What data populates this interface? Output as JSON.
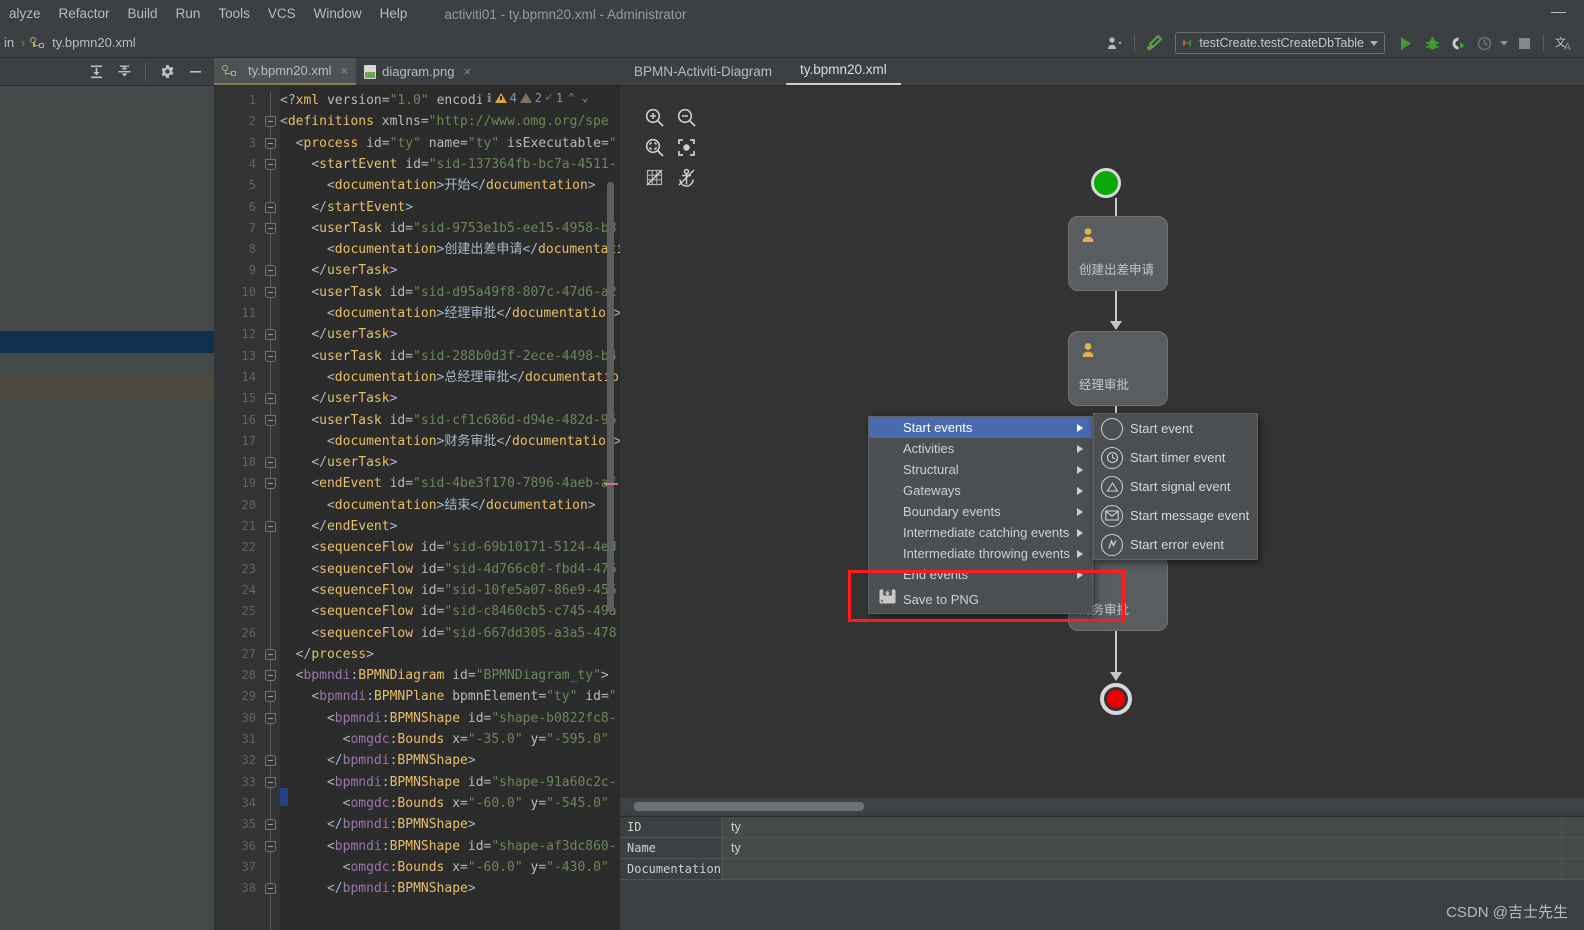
{
  "window": {
    "title": "activiti01 - ty.bpmn20.xml - Administrator",
    "minimize_label": "—"
  },
  "menubar": {
    "items": [
      {
        "label": "alyze"
      },
      {
        "label": "Refactor"
      },
      {
        "label": "Build"
      },
      {
        "label": "Run"
      },
      {
        "label": "Tools"
      },
      {
        "label": "VCS"
      },
      {
        "label": "Window"
      },
      {
        "label": "Help"
      }
    ]
  },
  "breadcrumb": {
    "segments": [
      "in",
      "ty.bpmn20.xml"
    ],
    "separator": "›"
  },
  "run_toolbar": {
    "config_name": "testCreate.testCreateDbTable",
    "icons": [
      "user-settings-icon",
      "build-hammer-icon",
      "run-icon",
      "debug-icon",
      "run-with-coverage-icon",
      "profile-icon",
      "stop-icon",
      "translate-icon"
    ]
  },
  "left_panel": {
    "toolbar_icons": [
      "expand-all-icon",
      "collapse-all-icon",
      "settings-gear-icon",
      "hide-icon"
    ]
  },
  "editor_tabs": [
    {
      "label": "ty.bpmn20.xml",
      "icon": "bpmn-file-icon",
      "active": true,
      "close": "×"
    },
    {
      "label": "diagram.png",
      "icon": "png-file-icon",
      "active": false,
      "close": "×"
    }
  ],
  "inspections": {
    "info_icon": "inspection-info-icon",
    "warning_count": "4",
    "weak_warning_count": "2",
    "ok_count": "1",
    "prev_label": "⌃",
    "next_label": "⌄"
  },
  "code": {
    "lines": [
      {
        "n": 1,
        "fold": null,
        "html": "<span class=\"k-ang\">&lt;?</span><span class=\"k-tag\">xml</span> <span class=\"k-attr\">version</span><span class=\"k-ang\">=</span><span class=\"k-str\">\"1.0\"</span> <span class=\"k-attr\">encodi</span>"
      },
      {
        "n": 2,
        "fold": "open",
        "html": "<span class=\"k-ang\">&lt;</span><span class=\"k-tag\">definitions</span> <span class=\"k-attr\">xmlns</span><span class=\"k-ang\">=</span><span class=\"k-str\">\"http://www.omg.org/spe</span>"
      },
      {
        "n": 3,
        "fold": "open",
        "html": "  <span class=\"k-ang\">&lt;</span><span class=\"k-tag\">process</span> <span class=\"k-attr\">id</span><span class=\"k-ang\">=</span><span class=\"k-str\">\"ty\"</span> <span class=\"k-attr\">name</span><span class=\"k-ang\">=</span><span class=\"k-str\">\"ty\"</span> <span class=\"k-attr\">isExecutable</span><span class=\"k-ang\">=</span><span class=\"k-str\">\"</span>"
      },
      {
        "n": 4,
        "fold": "open",
        "html": "    <span class=\"k-ang\">&lt;</span><span class=\"k-tag\">startEvent</span> <span class=\"k-attr\">id</span><span class=\"k-ang\">=</span><span class=\"k-str\">\"sid-137364fb-bc7a-4511-</span>"
      },
      {
        "n": 5,
        "fold": null,
        "html": "      <span class=\"k-ang\">&lt;</span><span class=\"k-tag\">documentation</span><span class=\"k-ang\">&gt;</span><span class=\"k-doc\">开始</span><span class=\"k-ang\">&lt;/</span><span class=\"k-tag\">documentation</span><span class=\"k-ang\">&gt;</span>"
      },
      {
        "n": 6,
        "fold": "close",
        "html": "    <span class=\"k-ang\">&lt;/</span><span class=\"k-tag\">startEvent</span><span class=\"k-ang\">&gt;</span>"
      },
      {
        "n": 7,
        "fold": "open",
        "html": "    <span class=\"k-ang\">&lt;</span><span class=\"k-tag\">userTask</span> <span class=\"k-attr\">id</span><span class=\"k-ang\">=</span><span class=\"k-str\">\"sid-9753e1b5-ee15-4958-b8</span>"
      },
      {
        "n": 8,
        "fold": null,
        "html": "      <span class=\"k-ang\">&lt;</span><span class=\"k-tag\">documentation</span><span class=\"k-ang\">&gt;</span><span class=\"k-doc\">创建出差申请</span><span class=\"k-ang\">&lt;/</span><span class=\"k-tag\">documentati</span>"
      },
      {
        "n": 9,
        "fold": "close",
        "html": "    <span class=\"k-ang\">&lt;/</span><span class=\"k-tag\">userTask</span><span class=\"k-ang\">&gt;</span>"
      },
      {
        "n": 10,
        "fold": "open",
        "html": "    <span class=\"k-ang\">&lt;</span><span class=\"k-tag\">userTask</span> <span class=\"k-attr\">id</span><span class=\"k-ang\">=</span><span class=\"k-str\">\"sid-d95a49f8-807c-47d6-a2</span>"
      },
      {
        "n": 11,
        "fold": null,
        "html": "      <span class=\"k-ang\">&lt;</span><span class=\"k-tag\">documentation</span><span class=\"k-ang\">&gt;</span><span class=\"k-doc\">经理审批</span><span class=\"k-ang\">&lt;/</span><span class=\"k-tag\">documentation</span><span class=\"k-ang\">&gt;</span>"
      },
      {
        "n": 12,
        "fold": "close",
        "html": "    <span class=\"k-ang\">&lt;/</span><span class=\"k-tag\">userTask</span><span class=\"k-ang\">&gt;</span>"
      },
      {
        "n": 13,
        "fold": "open",
        "html": "    <span class=\"k-ang\">&lt;</span><span class=\"k-tag\">userTask</span> <span class=\"k-attr\">id</span><span class=\"k-ang\">=</span><span class=\"k-str\">\"sid-288b0d3f-2ece-4498-b4</span>"
      },
      {
        "n": 14,
        "fold": null,
        "html": "      <span class=\"k-ang\">&lt;</span><span class=\"k-tag\">documentation</span><span class=\"k-ang\">&gt;</span><span class=\"k-doc\">总经理审批</span><span class=\"k-ang\">&lt;/</span><span class=\"k-tag\">documentatio</span>"
      },
      {
        "n": 15,
        "fold": "close",
        "html": "    <span class=\"k-ang\">&lt;/</span><span class=\"k-tag\">userTask</span><span class=\"k-ang\">&gt;</span>"
      },
      {
        "n": 16,
        "fold": "open",
        "html": "    <span class=\"k-ang\">&lt;</span><span class=\"k-tag\">userTask</span> <span class=\"k-attr\">id</span><span class=\"k-ang\">=</span><span class=\"k-str\">\"sid-cf1c686d-d94e-482d-95</span>"
      },
      {
        "n": 17,
        "fold": null,
        "html": "      <span class=\"k-ang\">&lt;</span><span class=\"k-tag\">documentation</span><span class=\"k-ang\">&gt;</span><span class=\"k-doc\">财务审批</span><span class=\"k-ang\">&lt;/</span><span class=\"k-tag\">documentation</span><span class=\"k-ang\">&gt;</span>"
      },
      {
        "n": 18,
        "fold": "close",
        "html": "    <span class=\"k-ang\">&lt;/</span><span class=\"k-tag\">userTask</span><span class=\"k-ang\">&gt;</span>"
      },
      {
        "n": 19,
        "fold": "open",
        "html": "    <span class=\"k-ang\">&lt;</span><span class=\"k-tag\">endEvent</span> <span class=\"k-attr\">id</span><span class=\"k-ang\">=</span><span class=\"k-str\">\"sid-4be3f170-7896-4aeb-af</span>"
      },
      {
        "n": 20,
        "fold": null,
        "html": "      <span class=\"k-ang\">&lt;</span><span class=\"k-tag\">documentation</span><span class=\"k-ang\">&gt;</span><span class=\"k-doc\">结束</span><span class=\"k-ang\">&lt;/</span><span class=\"k-tag\">documentation</span><span class=\"k-ang\">&gt;</span>"
      },
      {
        "n": 21,
        "fold": "close",
        "html": "    <span class=\"k-ang\">&lt;/</span><span class=\"k-tag\">endEvent</span><span class=\"k-ang\">&gt;</span>"
      },
      {
        "n": 22,
        "fold": null,
        "html": "    <span class=\"k-ang\">&lt;</span><span class=\"k-tag\">sequenceFlow</span> <span class=\"k-attr\">id</span><span class=\"k-ang\">=</span><span class=\"k-str\">\"sid-69b10171-5124-4ed</span>"
      },
      {
        "n": 23,
        "fold": null,
        "html": "    <span class=\"k-ang\">&lt;</span><span class=\"k-tag\">sequenceFlow</span> <span class=\"k-attr\">id</span><span class=\"k-ang\">=</span><span class=\"k-str\">\"sid-4d766c0f-fbd4-476</span>"
      },
      {
        "n": 24,
        "fold": null,
        "html": "    <span class=\"k-ang\">&lt;</span><span class=\"k-tag\">sequenceFlow</span> <span class=\"k-attr\">id</span><span class=\"k-ang\">=</span><span class=\"k-str\">\"sid-10fe5a07-86e9-456</span>"
      },
      {
        "n": 25,
        "fold": null,
        "html": "    <span class=\"k-ang\">&lt;</span><span class=\"k-tag\">sequenceFlow</span> <span class=\"k-attr\">id</span><span class=\"k-ang\">=</span><span class=\"k-str\">\"sid-c8460cb5-c745-49a</span>"
      },
      {
        "n": 26,
        "fold": null,
        "html": "    <span class=\"k-ang\">&lt;</span><span class=\"k-tag\">sequenceFlow</span> <span class=\"k-attr\">id</span><span class=\"k-ang\">=</span><span class=\"k-str\">\"sid-667dd305-a3a5-478</span>"
      },
      {
        "n": 27,
        "fold": "close",
        "html": "  <span class=\"k-ang\">&lt;/</span><span class=\"k-tag\">process</span><span class=\"k-ang\">&gt;</span>"
      },
      {
        "n": 28,
        "fold": "open",
        "html": "  <span class=\"k-ang\">&lt;</span><span class=\"k-ns\">bpmndi</span><span class=\"k-ang\">:</span><span class=\"k-tag\">BPMNDiagram</span> <span class=\"k-attr\">id</span><span class=\"k-ang\">=</span><span class=\"k-str\">\"BPMNDiagram_ty\"</span><span class=\"k-ang\">&gt;</span>"
      },
      {
        "n": 29,
        "fold": "open",
        "html": "    <span class=\"k-ang\">&lt;</span><span class=\"k-ns\">bpmndi</span><span class=\"k-ang\">:</span><span class=\"k-tag\">BPMNPlane</span> <span class=\"k-attr\">bpmnElement</span><span class=\"k-ang\">=</span><span class=\"k-str\">\"ty\"</span> <span class=\"k-attr\">id</span><span class=\"k-ang\">=</span><span class=\"k-str\">\"</span>"
      },
      {
        "n": 30,
        "fold": "open",
        "html": "      <span class=\"k-ang\">&lt;</span><span class=\"k-ns\">bpmndi</span><span class=\"k-ang\">:</span><span class=\"k-tag\">BPMNShape</span> <span class=\"k-attr\">id</span><span class=\"k-ang\">=</span><span class=\"k-str\">\"shape-b0822fc8-</span>"
      },
      {
        "n": 31,
        "fold": null,
        "html": "        <span class=\"k-ang\">&lt;</span><span class=\"k-ns\">omgdc</span><span class=\"k-ang\">:</span><span class=\"k-tag\">Bounds</span> <span class=\"k-attr\">x</span><span class=\"k-ang\">=</span><span class=\"k-str\">\"-35.0\"</span> <span class=\"k-attr\">y</span><span class=\"k-ang\">=</span><span class=\"k-str\">\"-595.0\"</span> "
      },
      {
        "n": 32,
        "fold": "close",
        "html": "      <span class=\"k-ang\">&lt;/</span><span class=\"k-ns\">bpmndi</span><span class=\"k-ang\">:</span><span class=\"k-tag\">BPMNShape</span><span class=\"k-ang\">&gt;</span>"
      },
      {
        "n": 33,
        "fold": "open",
        "html": "      <span class=\"k-ang\">&lt;</span><span class=\"k-ns\">bpmndi</span><span class=\"k-ang\">:</span><span class=\"k-tag\">BPMNShape</span> <span class=\"k-attr\">id</span><span class=\"k-ang\">=</span><span class=\"k-str\">\"shape-91a60c2c-</span>"
      },
      {
        "n": 34,
        "fold": null,
        "html": "        <span class=\"k-ang\">&lt;</span><span class=\"k-ns\">omgdc</span><span class=\"k-ang\">:</span><span class=\"k-tag\">Bounds</span> <span class=\"k-attr\">x</span><span class=\"k-ang\">=</span><span class=\"k-str\">\"-60.0\"</span> <span class=\"k-attr\">y</span><span class=\"k-ang\">=</span><span class=\"k-str\">\"-545.0\"</span> "
      },
      {
        "n": 35,
        "fold": "close",
        "html": "      <span class=\"k-ang\">&lt;/</span><span class=\"k-ns\">bpmndi</span><span class=\"k-ang\">:</span><span class=\"k-tag\">BPMNShape</span><span class=\"k-ang\">&gt;</span>"
      },
      {
        "n": 36,
        "fold": "open",
        "html": "      <span class=\"k-ang\">&lt;</span><span class=\"k-ns\">bpmndi</span><span class=\"k-ang\">:</span><span class=\"k-tag\">BPMNShape</span> <span class=\"k-attr\">id</span><span class=\"k-ang\">=</span><span class=\"k-str\">\"shape-af3dc860-</span>"
      },
      {
        "n": 37,
        "fold": null,
        "html": "        <span class=\"k-ang\">&lt;</span><span class=\"k-ns\">omgdc</span><span class=\"k-ang\">:</span><span class=\"k-tag\">Bounds</span> <span class=\"k-attr\">x</span><span class=\"k-ang\">=</span><span class=\"k-str\">\"-60.0\"</span> <span class=\"k-attr\">y</span><span class=\"k-ang\">=</span><span class=\"k-str\">\"-430.0\"</span> "
      },
      {
        "n": 38,
        "fold": "close",
        "html": "      <span class=\"k-ang\">&lt;/</span><span class=\"k-ns\">bpmndi</span><span class=\"k-ang\">:</span><span class=\"k-tag\">BPMNShape</span><span class=\"k-ang\">&gt;</span>"
      }
    ]
  },
  "diagram": {
    "tabs": [
      {
        "label": "BPMN-Activiti-Diagram",
        "active": false
      },
      {
        "label": "ty.bpmn20.xml",
        "active": true
      }
    ],
    "toolbar": [
      {
        "name": "zoom-in-icon"
      },
      {
        "name": "zoom-out-icon"
      },
      {
        "name": "fit-content-icon"
      },
      {
        "name": "actual-size-icon"
      },
      {
        "name": "toggle-grid-icon"
      },
      {
        "name": "toggle-snap-anchor-icon"
      }
    ],
    "nodes": [
      {
        "type": "start-event",
        "label": "",
        "color": "#0aa80a"
      },
      {
        "type": "user-task",
        "label": "创建出差申请"
      },
      {
        "type": "user-task",
        "label": "经理审批"
      },
      {
        "type": "user-task",
        "label": "总经理审批"
      },
      {
        "type": "user-task",
        "label": "财务审批"
      },
      {
        "type": "end-event",
        "label": "",
        "color": "#ee0000"
      }
    ]
  },
  "context_menu": {
    "items": [
      {
        "label": "Start events",
        "submenu": true,
        "selected": true
      },
      {
        "label": "Activities",
        "submenu": true,
        "selected": false
      },
      {
        "label": "Structural",
        "submenu": true,
        "selected": false
      },
      {
        "label": "Gateways",
        "submenu": true,
        "selected": false
      },
      {
        "label": "Boundary events",
        "submenu": true,
        "selected": false
      },
      {
        "label": "Intermediate catching events",
        "submenu": true,
        "selected": false
      },
      {
        "label": "Intermediate throwing events",
        "submenu": true,
        "selected": false
      },
      {
        "label": "End events",
        "submenu": true,
        "selected": false
      },
      {
        "label": "Save to PNG",
        "submenu": false,
        "selected": false,
        "icon": "save-png-icon"
      }
    ]
  },
  "submenu": {
    "items": [
      {
        "label": "Start event",
        "icon": "circle-icon"
      },
      {
        "label": "Start timer event",
        "icon": "timer-icon"
      },
      {
        "label": "Start signal event",
        "icon": "signal-triangle-icon"
      },
      {
        "label": "Start message event",
        "icon": "envelope-icon"
      },
      {
        "label": "Start error event",
        "icon": "error-zigzag-icon"
      }
    ]
  },
  "properties": {
    "rows": [
      {
        "key": "ID",
        "value": "ty"
      },
      {
        "key": "Name",
        "value": "ty"
      },
      {
        "key": "Documentation",
        "value": ""
      }
    ]
  },
  "watermark": "CSDN @吉士先生",
  "colors": {
    "accent_selection": "#4a6ab0",
    "highlight_red": "#ff1b1b",
    "start_green": "#0aa80a",
    "end_red": "#ee0000",
    "editor_bg": "#2b2b2b",
    "panel_bg": "#3c3f41"
  }
}
